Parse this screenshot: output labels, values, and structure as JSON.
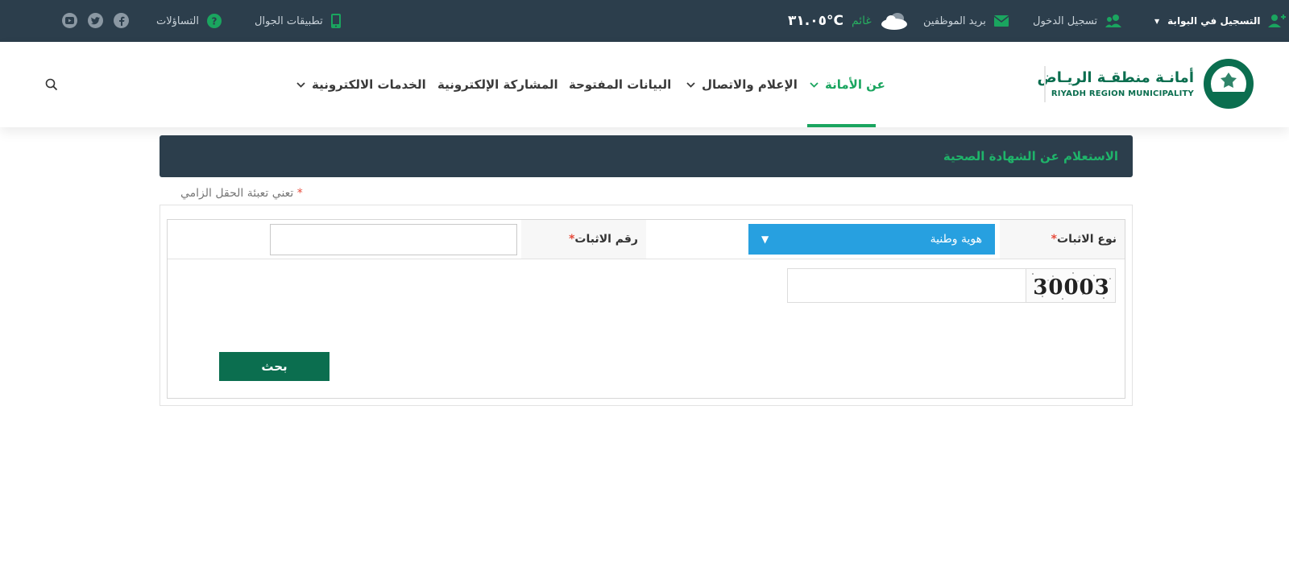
{
  "topbar": {
    "portal_register": "التسجيل في البوابة",
    "login": "تسجيل الدخول",
    "employee_mail": "بريد الموظفين",
    "weather_desc": "غائم",
    "weather_temp": "٣١.٠٥°C",
    "mobile_apps": "تطبيقات الجوال",
    "faq": "التساؤلات",
    "social": [
      "facebook-icon",
      "twitter-icon",
      "youtube-icon"
    ]
  },
  "logo": {
    "arabic": "أمانـة منطقـة الريـاض",
    "english": "RIYADH REGION MUNICIPALITY"
  },
  "nav": {
    "about": "عن الأمانة",
    "media": "الإعلام والاتصال",
    "open_data": "البيانات المفتوحة",
    "e_participation": "المشاركة الإلكترونية",
    "e_services": "الخدمات الالكترونية"
  },
  "panel": {
    "title": "الاستعلام عن الشهادة الصحية",
    "required_note": "تعني تعبئة الحقل الزامي"
  },
  "form": {
    "id_type_label": "نوع الاثبات",
    "id_type_value": "هوية وطنية",
    "id_number_label": "رقم الاثبات",
    "id_number_value": "",
    "captcha_text": "30003",
    "captcha_value": "",
    "search_button": "بحث"
  },
  "colors": {
    "topbar": "#2c3e4c",
    "accent": "#1aa55f",
    "brand": "#0b6e4f",
    "select": "#27a0e0"
  }
}
